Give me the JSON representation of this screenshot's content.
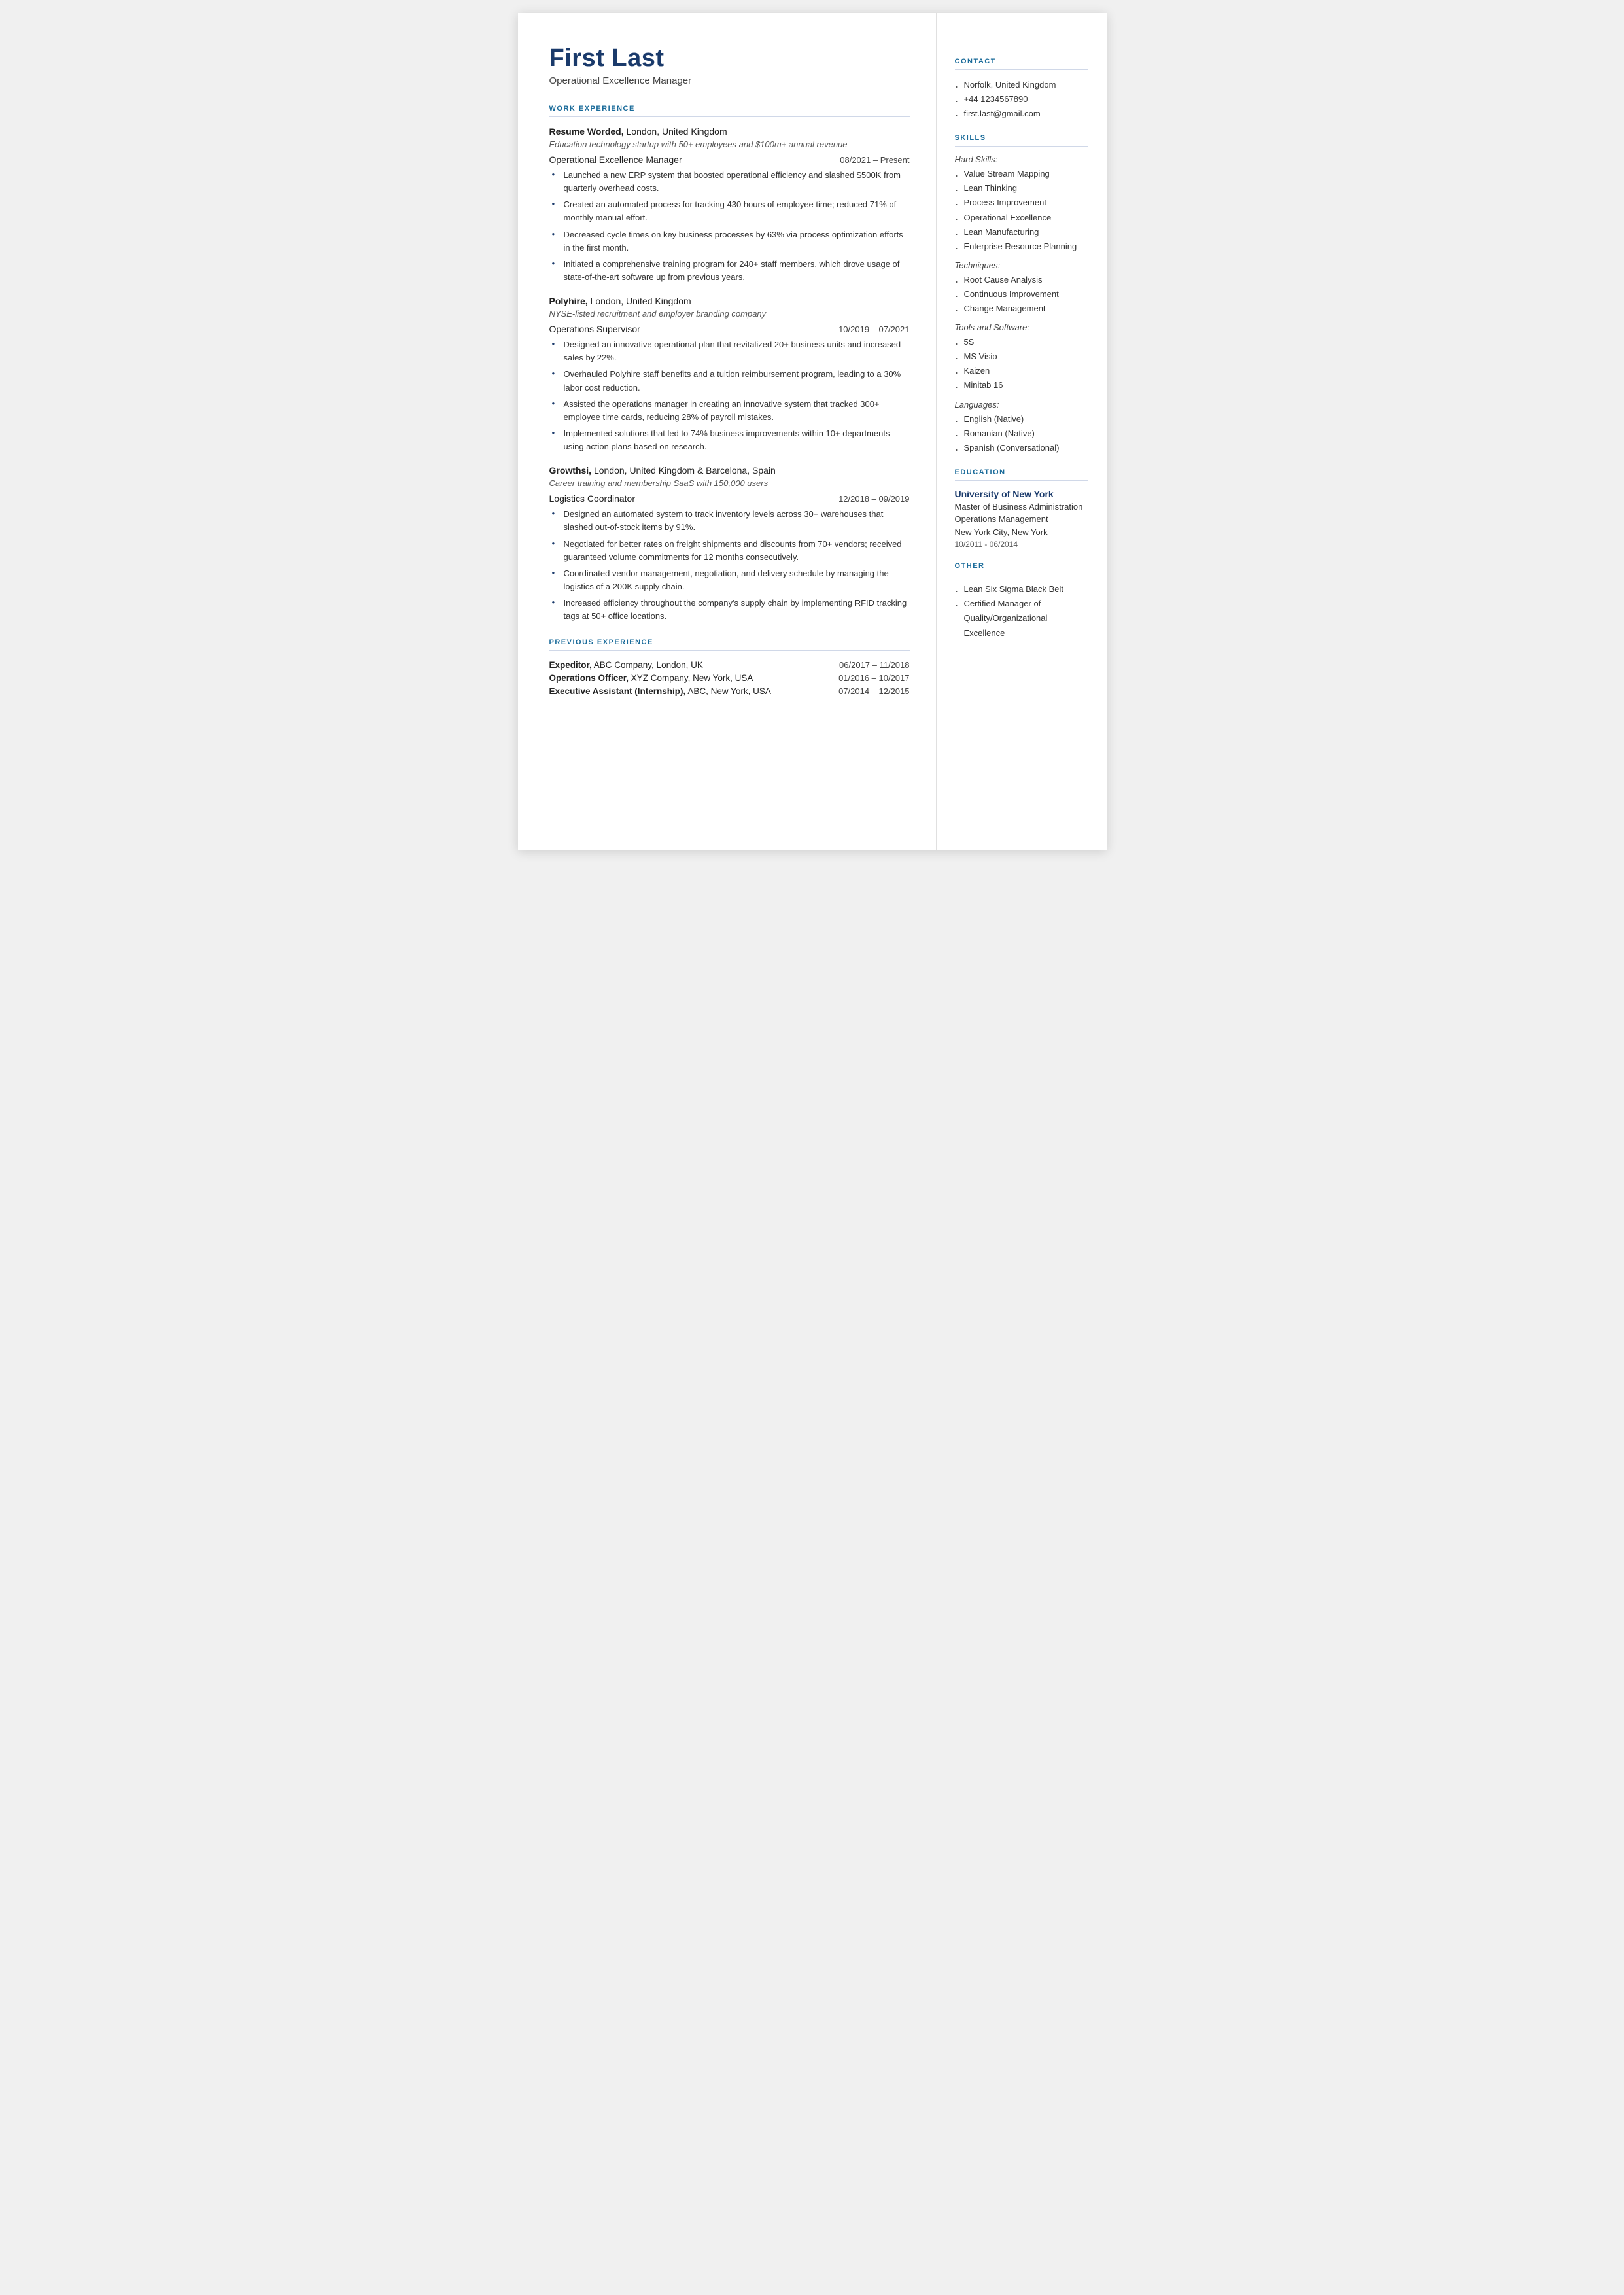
{
  "header": {
    "name": "First Last",
    "title": "Operational Excellence Manager"
  },
  "sections": {
    "work_experience_label": "WORK EXPERIENCE",
    "previous_experience_label": "PREVIOUS EXPERIENCE"
  },
  "jobs": [
    {
      "company": "Resume Worded,",
      "location": " London, United Kingdom",
      "description": "Education technology startup with 50+ employees and $100m+ annual revenue",
      "role": "Operational Excellence Manager",
      "dates": "08/2021 – Present",
      "bullets": [
        "Launched a new ERP system that boosted operational efficiency and slashed $500K from quarterly overhead costs.",
        "Created an automated process for tracking 430 hours of employee time; reduced 71% of monthly manual effort.",
        "Decreased cycle times on key business processes by 63% via process optimization efforts in the first month.",
        "Initiated a comprehensive training program for 240+ staff members, which drove usage of state-of-the-art software up from previous years."
      ]
    },
    {
      "company": "Polyhire,",
      "location": " London, United Kingdom",
      "description": "NYSE-listed recruitment and employer branding company",
      "role": "Operations Supervisor",
      "dates": "10/2019 – 07/2021",
      "bullets": [
        "Designed an innovative operational plan that revitalized 20+ business units and increased sales by 22%.",
        "Overhauled Polyhire staff benefits and a tuition reimbursement program, leading to a 30% labor cost reduction.",
        "Assisted the operations manager in creating an innovative system that tracked 300+ employee time cards, reducing 28% of payroll mistakes.",
        "Implemented solutions that led to 74% business improvements within 10+ departments using action plans based on research."
      ]
    },
    {
      "company": "Growthsi,",
      "location": " London, United Kingdom & Barcelona, Spain",
      "description": "Career training and membership SaaS with 150,000 users",
      "role": "Logistics Coordinator",
      "dates": "12/2018 – 09/2019",
      "bullets": [
        "Designed an automated system to track inventory levels across 30+ warehouses that slashed out-of-stock items by 91%.",
        "Negotiated for better rates on freight shipments and discounts from 70+ vendors; received guaranteed volume commitments for 12 months consecutively.",
        "Coordinated vendor management, negotiation, and delivery schedule by managing the logistics of a 200K supply chain.",
        "Increased efficiency throughout the company's supply chain by implementing RFID tracking tags at 50+ office locations."
      ]
    }
  ],
  "previous_experience": [
    {
      "label_bold": "Expeditor,",
      "label_rest": " ABC Company, London, UK",
      "dates": "06/2017 – 11/2018"
    },
    {
      "label_bold": "Operations Officer,",
      "label_rest": " XYZ Company, New York, USA",
      "dates": "01/2016 – 10/2017"
    },
    {
      "label_bold": "Executive Assistant (Internship),",
      "label_rest": " ABC, New York, USA",
      "dates": "07/2014 – 12/2015"
    }
  ],
  "sidebar": {
    "contact_label": "CONTACT",
    "contact_items": [
      "Norfolk, United Kingdom",
      "+44 1234567890",
      "first.last@gmail.com"
    ],
    "skills_label": "SKILLS",
    "hard_skills_label": "Hard Skills:",
    "hard_skills": [
      "Value Stream Mapping",
      "Lean Thinking",
      "Process Improvement",
      "Operational Excellence",
      "Lean Manufacturing",
      "Enterprise Resource Planning"
    ],
    "techniques_label": "Techniques:",
    "techniques": [
      "Root Cause Analysis",
      "Continuous Improvement",
      "Change Management"
    ],
    "tools_label": "Tools and Software:",
    "tools": [
      "5S",
      "MS Visio",
      "Kaizen",
      "Minitab 16"
    ],
    "languages_label": "Languages:",
    "languages": [
      "English (Native)",
      "Romanian (Native)",
      "Spanish (Conversational)"
    ],
    "education_label": "EDUCATION",
    "education": [
      {
        "school": "University of New York",
        "degree": "Master of Business Administration",
        "field": "Operations Management",
        "location": "New York City, New York",
        "dates": "10/2011 - 06/2014"
      }
    ],
    "other_label": "OTHER",
    "other_items": [
      "Lean Six Sigma Black Belt",
      "Certified Manager of Quality/Organizational Excellence"
    ]
  }
}
